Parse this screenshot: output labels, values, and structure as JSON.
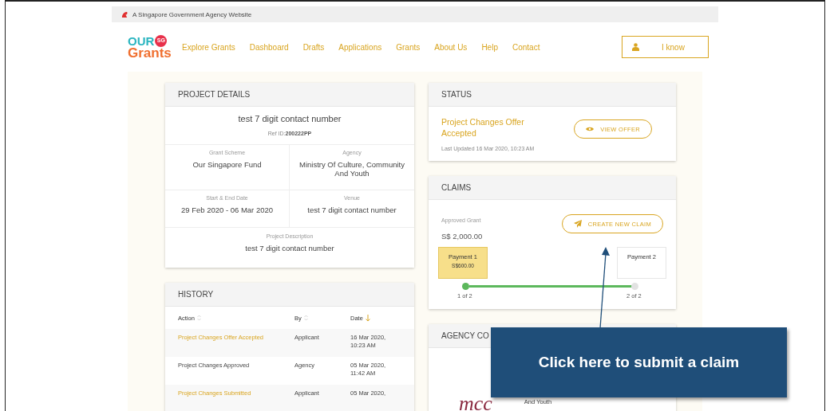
{
  "gov_banner": {
    "text": "A Singapore Government Agency Website"
  },
  "logo": {
    "line_1": "OUR",
    "badge": "SG",
    "line_2": "Grants"
  },
  "nav": {
    "items": [
      {
        "label": "Explore Grants"
      },
      {
        "label": "Dashboard"
      },
      {
        "label": "Drafts"
      },
      {
        "label": "Applications"
      },
      {
        "label": "Grants"
      },
      {
        "label": "About Us"
      },
      {
        "label": "Help"
      },
      {
        "label": "Contact"
      }
    ]
  },
  "user_button": {
    "label": "I know"
  },
  "project_details": {
    "title": "PROJECT DETAILS",
    "project_name": "test 7 digit contact number",
    "ref_label": "Ref ID:",
    "ref_value": "200222PP",
    "fields": [
      {
        "label": "Grant Scheme",
        "value": "Our Singapore Fund"
      },
      {
        "label": "Agency",
        "value": "Ministry Of Culture, Community And Youth"
      },
      {
        "label": "Start & End Date",
        "value": "29 Feb 2020 - 06 Mar 2020"
      },
      {
        "label": "Venue",
        "value": "test 7 digit contact number"
      }
    ],
    "description": {
      "label": "Project Description",
      "value": "test 7 digit contact number"
    }
  },
  "history": {
    "title": "HISTORY",
    "columns": [
      {
        "label": "Action",
        "sorted": false
      },
      {
        "label": "By",
        "sorted": false
      },
      {
        "label": "Date",
        "sorted": true
      }
    ],
    "rows": [
      {
        "action": "Project Changes Offer Accepted",
        "by": "Applicant",
        "date": "16 Mar 2020, 10:23 AM",
        "highlighted": true
      },
      {
        "action": "Project Changes Approved",
        "by": "Agency",
        "date": "05 Mar 2020, 11:42 AM",
        "highlighted": false
      },
      {
        "action": "Project Changes Submitted",
        "by": "Applicant",
        "date": "05 Mar 2020,",
        "highlighted": true
      }
    ]
  },
  "status": {
    "title": "STATUS",
    "status_text": "Project Changes Offer Accepted",
    "button": "VIEW OFFER",
    "last_updated": "Last Updated 16 Mar 2020, 10:23 AM"
  },
  "claims": {
    "title": "CLAIMS",
    "approved_label": "Approved Grant",
    "approved_value": "S$ 2,000.00",
    "button": "CREATE NEW CLAIM",
    "payments": [
      {
        "label": "Payment 1",
        "amount": "S$600.00",
        "step": "1 of 2",
        "selected": true,
        "done": true
      },
      {
        "label": "Payment 2",
        "step": "2 of 2",
        "selected": false,
        "done": false
      }
    ]
  },
  "agency": {
    "title": "AGENCY CO",
    "logo_text": "mcc",
    "name_tail": "And Youth"
  },
  "callout": {
    "text": "Click here to submit a claim"
  }
}
